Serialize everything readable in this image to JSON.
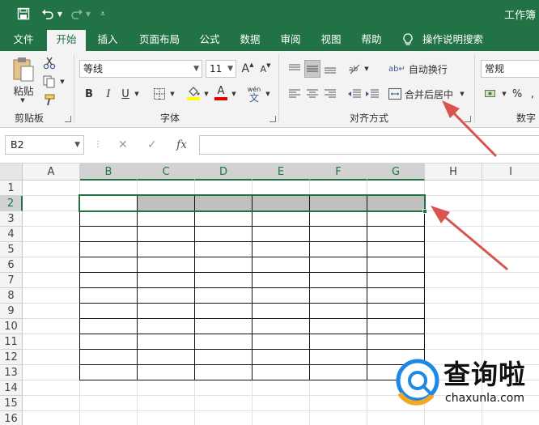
{
  "window": {
    "title": "工作簿"
  },
  "tabs": [
    {
      "label": "文件",
      "active": false
    },
    {
      "label": "开始",
      "active": true
    },
    {
      "label": "插入",
      "active": false
    },
    {
      "label": "页面布局",
      "active": false
    },
    {
      "label": "公式",
      "active": false
    },
    {
      "label": "数据",
      "active": false
    },
    {
      "label": "审阅",
      "active": false
    },
    {
      "label": "视图",
      "active": false
    },
    {
      "label": "帮助",
      "active": false
    }
  ],
  "tell_me": {
    "label": "操作说明搜索",
    "icon": "lightbulb-icon"
  },
  "clipboard": {
    "group_label": "剪贴板",
    "paste_label": "粘贴"
  },
  "font": {
    "group_label": "字体",
    "name": "等线",
    "size": "11",
    "bold_label": "B",
    "italic_label": "I",
    "underline_label": "U",
    "grow_label": "A",
    "shrink_label": "A",
    "phonetic_top": "wén",
    "phonetic_bottom": "文",
    "fill_color": "#ffff00",
    "font_color": "#e00000"
  },
  "alignment": {
    "group_label": "对齐方式",
    "wrap_text_label": "自动换行",
    "merge_center_label": "合并后居中"
  },
  "number": {
    "group_label": "数字",
    "format": "常规",
    "percent_label": "%"
  },
  "formula_bar": {
    "name_box": "B2",
    "fx_label": "fx",
    "value": ""
  },
  "sheet": {
    "columns": [
      "A",
      "B",
      "C",
      "D",
      "E",
      "F",
      "G",
      "H",
      "I"
    ],
    "rows": [
      "1",
      "2",
      "3",
      "4",
      "5",
      "6",
      "7",
      "8",
      "9",
      "10",
      "11",
      "12",
      "13",
      "14",
      "15",
      "16"
    ],
    "active_cell": "B2",
    "selected_range": "B2:G2",
    "bordered_range": "B2:G13"
  },
  "colors": {
    "brand_green": "#217346",
    "selection_gray": "#c0c0c0",
    "arrow_red": "#d9534f"
  },
  "watermark": {
    "name": "查询啦",
    "site": "chaxunla.com"
  }
}
